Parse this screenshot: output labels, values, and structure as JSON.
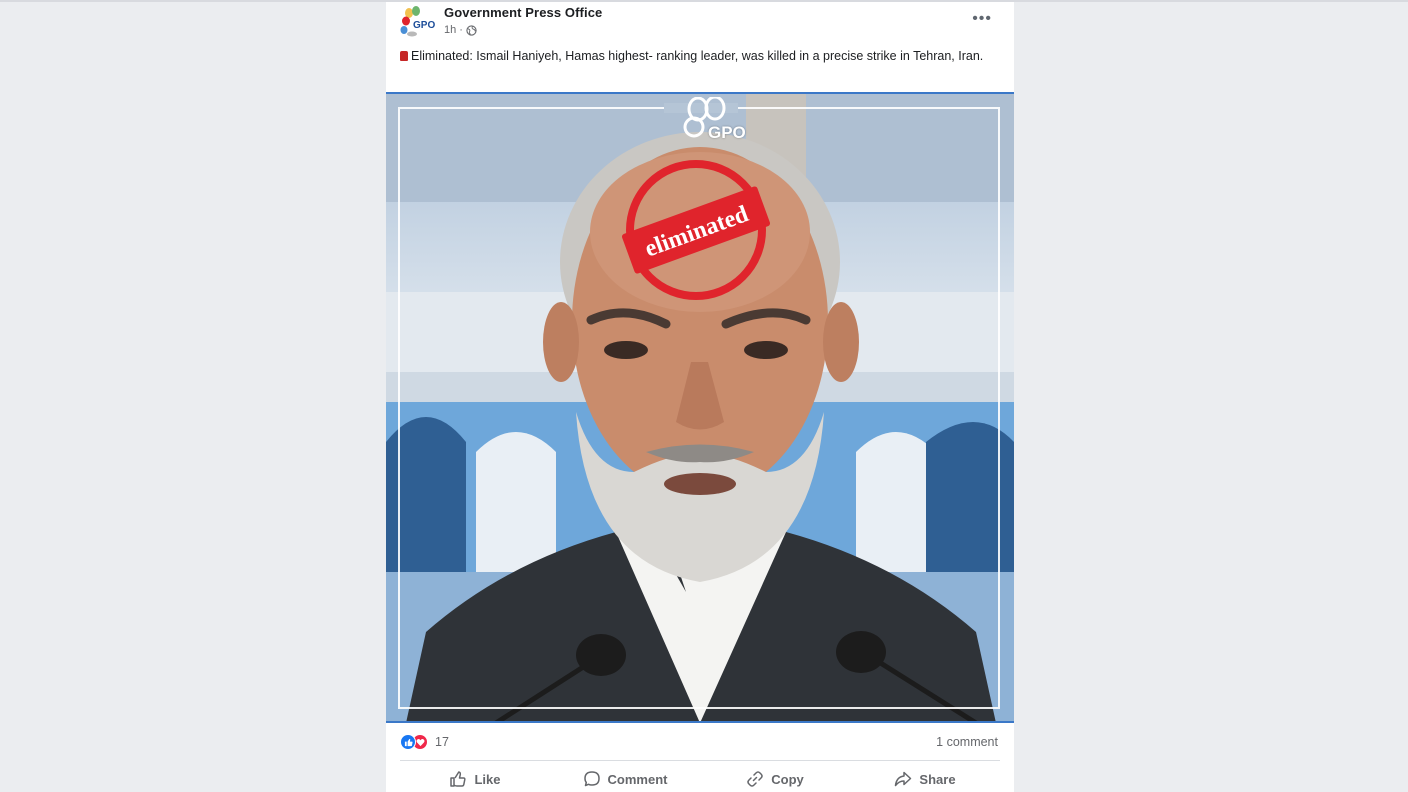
{
  "post": {
    "page_name": "Government Press Office",
    "time": "1h",
    "privacy_icon": "globe-icon",
    "more_label": "•••",
    "caption": "Eliminated: Ismail Haniyeh, Hamas highest- ranking leader, was killed in a precise strike in Tehran, Iran.",
    "avatar_text": "GPO"
  },
  "image": {
    "watermark_text": "GPO",
    "stamp_text": "eliminated"
  },
  "stats": {
    "reaction_count": "17",
    "comment_count": "1 comment"
  },
  "actions": [
    {
      "label": "Like",
      "icon": "thumbs-up-icon"
    },
    {
      "label": "Comment",
      "icon": "comment-icon"
    },
    {
      "label": "Copy",
      "icon": "link-icon"
    },
    {
      "label": "Share",
      "icon": "share-icon"
    }
  ],
  "colors": {
    "accent": "#1877f2",
    "love": "#f0284a",
    "stamp": "#e0242c",
    "background": "#ebedf0"
  }
}
